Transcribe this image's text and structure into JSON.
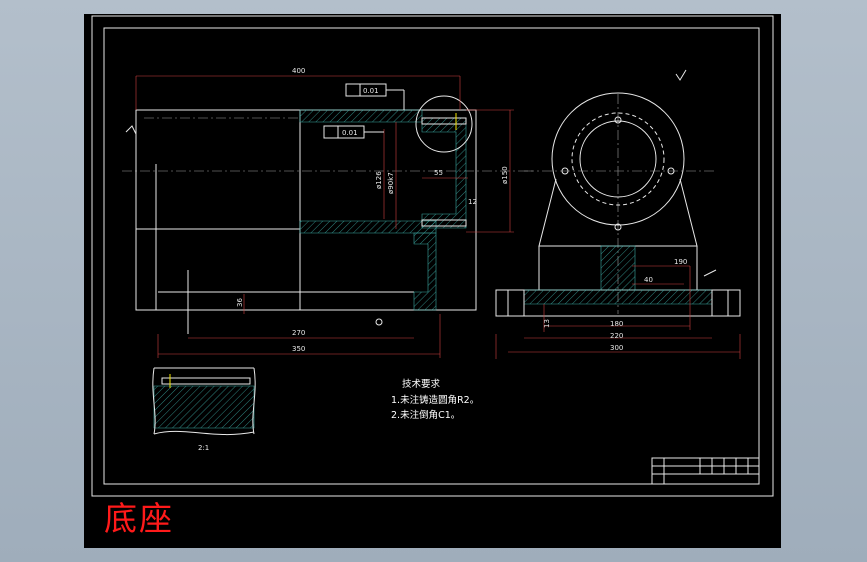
{
  "title": "底座",
  "tech_requirements": {
    "heading": "技术要求",
    "items": [
      "1.未注铸造圆角R2。",
      "2.未注倒角C1。"
    ]
  },
  "scale_label": "2:1",
  "dimensions": {
    "d400": "400",
    "d270": "270",
    "d350": "350",
    "d36": "36",
    "d126": "ø126",
    "d90": "ø90k7",
    "d55": "55",
    "d150": "ø150",
    "d12": "12",
    "d190": "190",
    "d40": "40",
    "d180": "180",
    "d220": "220",
    "d300": "300",
    "d13": "13",
    "tol1": "0.01",
    "tol2": "0.01"
  },
  "colors": {
    "background": "#a9b6c3",
    "sheet": "#000000",
    "lines": "#e8e8e8",
    "hatch": "#3aa6a0",
    "title": "#ff1a1a"
  }
}
